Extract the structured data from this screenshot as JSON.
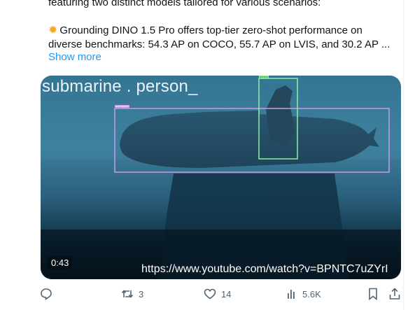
{
  "tweet": {
    "line1": "featuring two distinct models tailored for various scenarios:",
    "line2": "Grounding DINO 1.5 Pro offers top-tier zero-shot performance on",
    "line3": "diverse benchmarks: 54.3 AP on COCO, 55.7 AP on LVIS, and 30.2 AP ...",
    "sun_icon": "sun-emoji",
    "show_more": "Show more"
  },
  "media": {
    "caption": "submarine . person_",
    "duration": "0:43",
    "url": "https://www.youtube.com/watch?v=BPNTC7uZYrI",
    "boxes": [
      {
        "label": "submarine",
        "color": "#c99be6"
      },
      {
        "label": "person",
        "color": "#8ef0a3"
      }
    ]
  },
  "actions": {
    "reply": {
      "icon": "reply-icon",
      "count": ""
    },
    "repost": {
      "icon": "repost-icon",
      "count": "3"
    },
    "like": {
      "icon": "heart-icon",
      "count": "14"
    },
    "views": {
      "icon": "views-icon",
      "count": "5.6K"
    },
    "bookmark": {
      "icon": "bookmark-icon"
    },
    "share": {
      "icon": "share-icon"
    }
  },
  "colors": {
    "link": "#1d9bf0",
    "muted": "#536471",
    "text": "#0f1419"
  }
}
